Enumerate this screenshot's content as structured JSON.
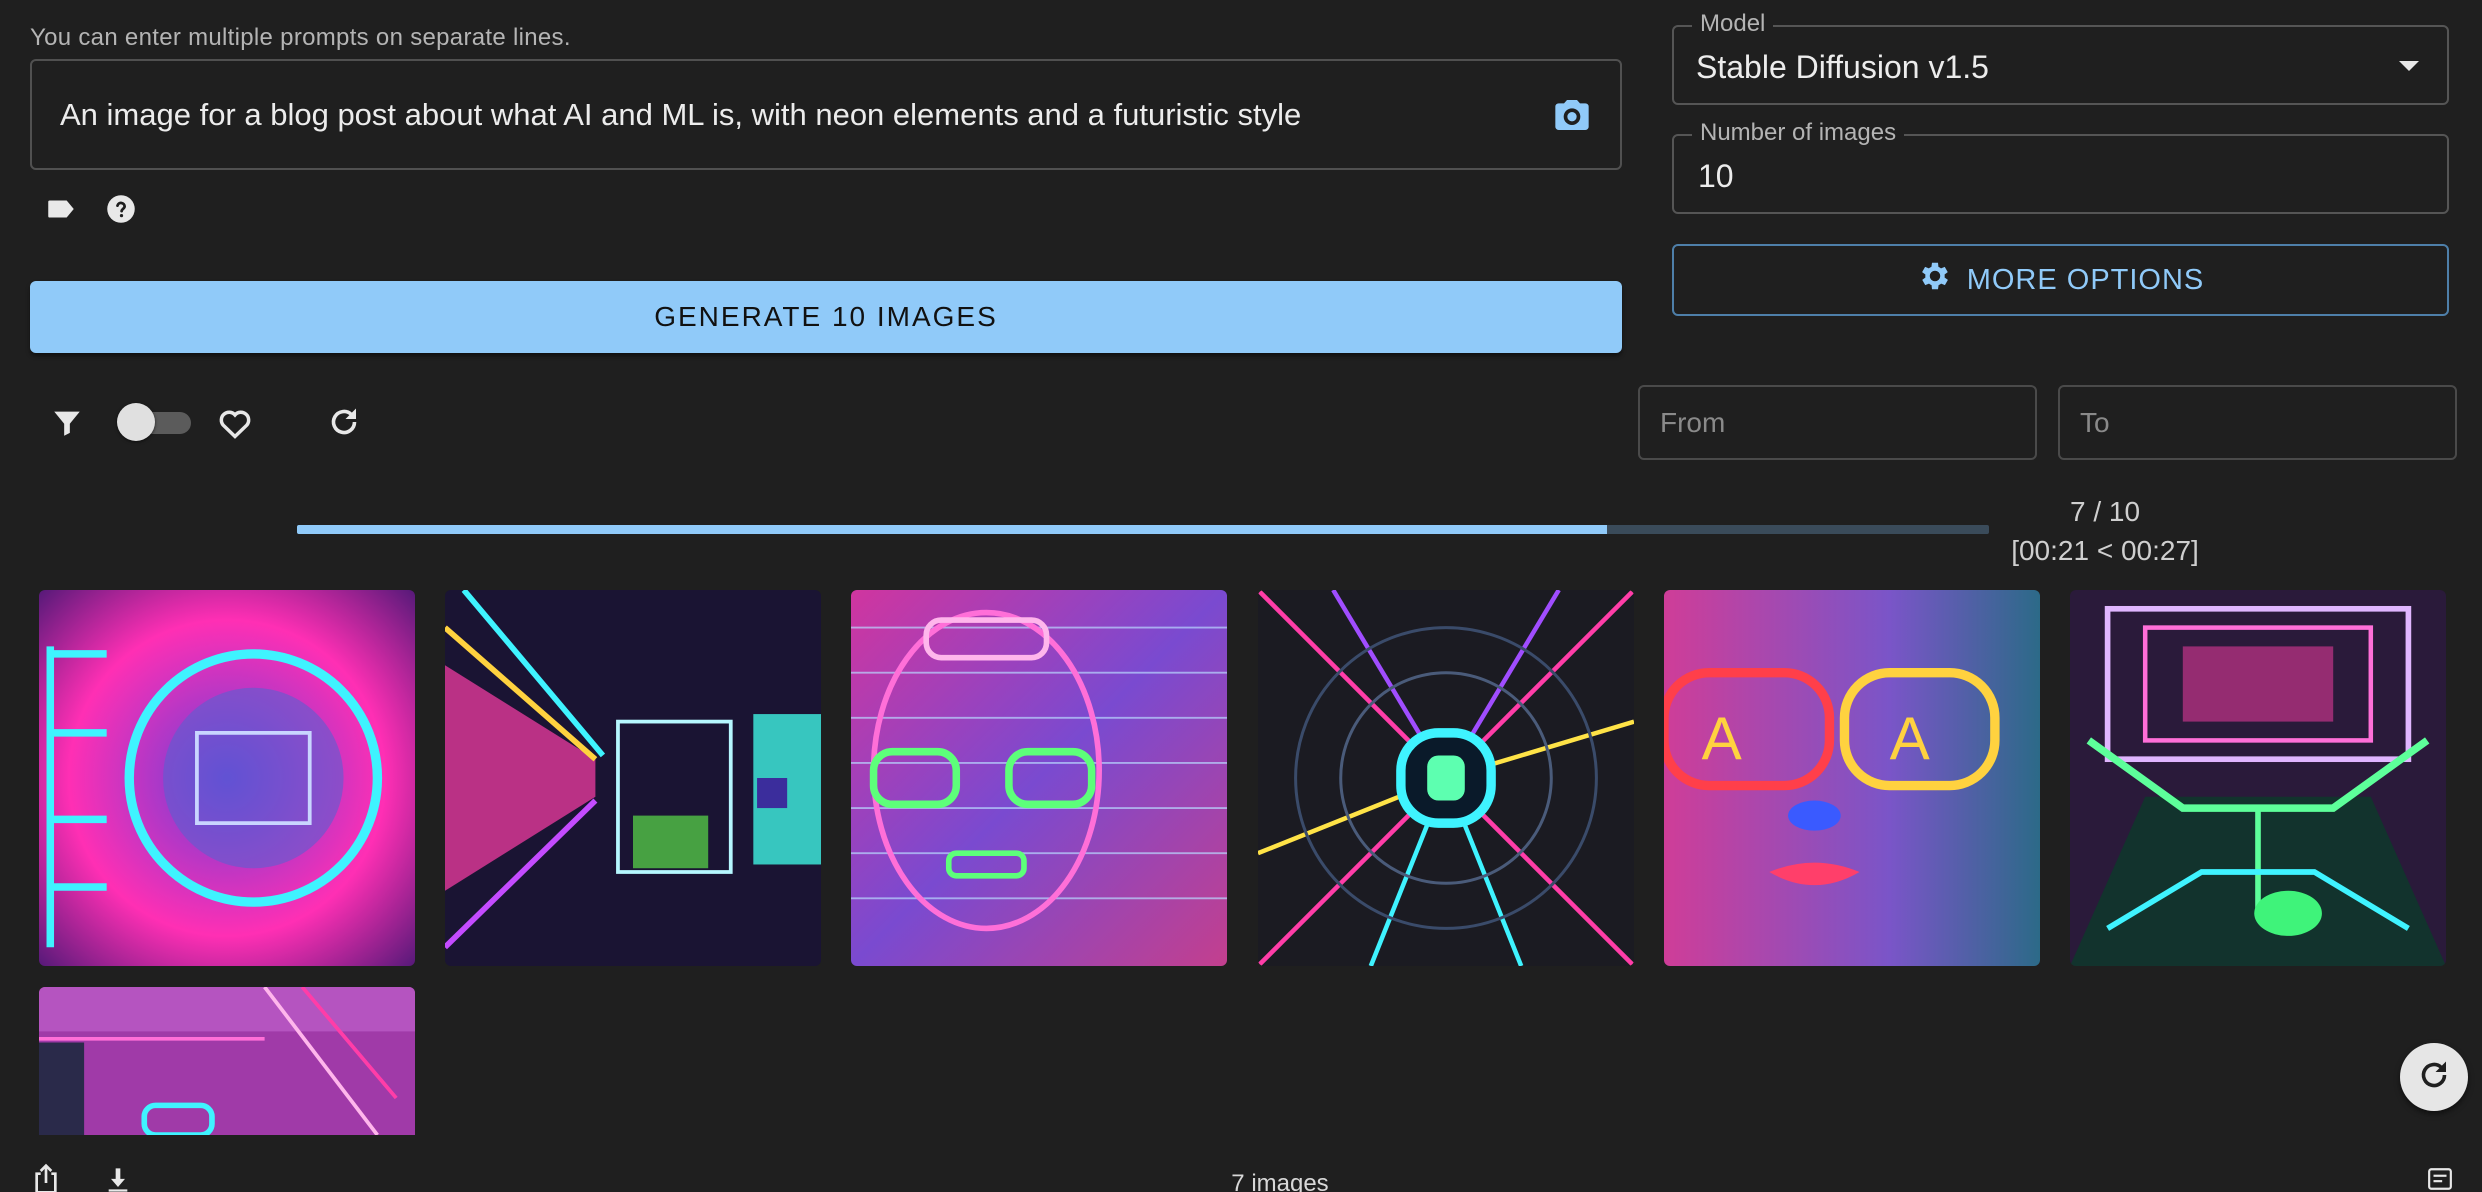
{
  "prompt": {
    "hint": "You can enter multiple prompts on separate lines.",
    "text": "An image for a blog post about what AI and ML is, with neon elements and a futuristic style"
  },
  "model": {
    "label": "Model",
    "value": "Stable Diffusion v1.5"
  },
  "num_images": {
    "label": "Number of images",
    "value": "10"
  },
  "generate_label": "GENERATE 10 IMAGES",
  "more_options_label": "MORE OPTIONS",
  "date_range": {
    "from_placeholder": "From",
    "to_placeholder": "To"
  },
  "filter": {
    "favorites_only": false
  },
  "progress": {
    "count": "7 / 10",
    "time": "[00:21 < 00:27]",
    "fraction": 0.774
  },
  "gallery": {
    "count_label": "7 images"
  },
  "colors": {
    "accent": "#90caf9",
    "background": "#1f1f1f",
    "border": "#505050"
  },
  "icons": {
    "camera": "camera-icon",
    "tag": "label-icon",
    "help": "help-icon",
    "filter": "filter-icon",
    "favorite": "heart-outline-icon",
    "refresh": "refresh-icon",
    "settings": "gear-icon",
    "share": "share-icon",
    "download": "download-icon",
    "list": "list-icon"
  }
}
